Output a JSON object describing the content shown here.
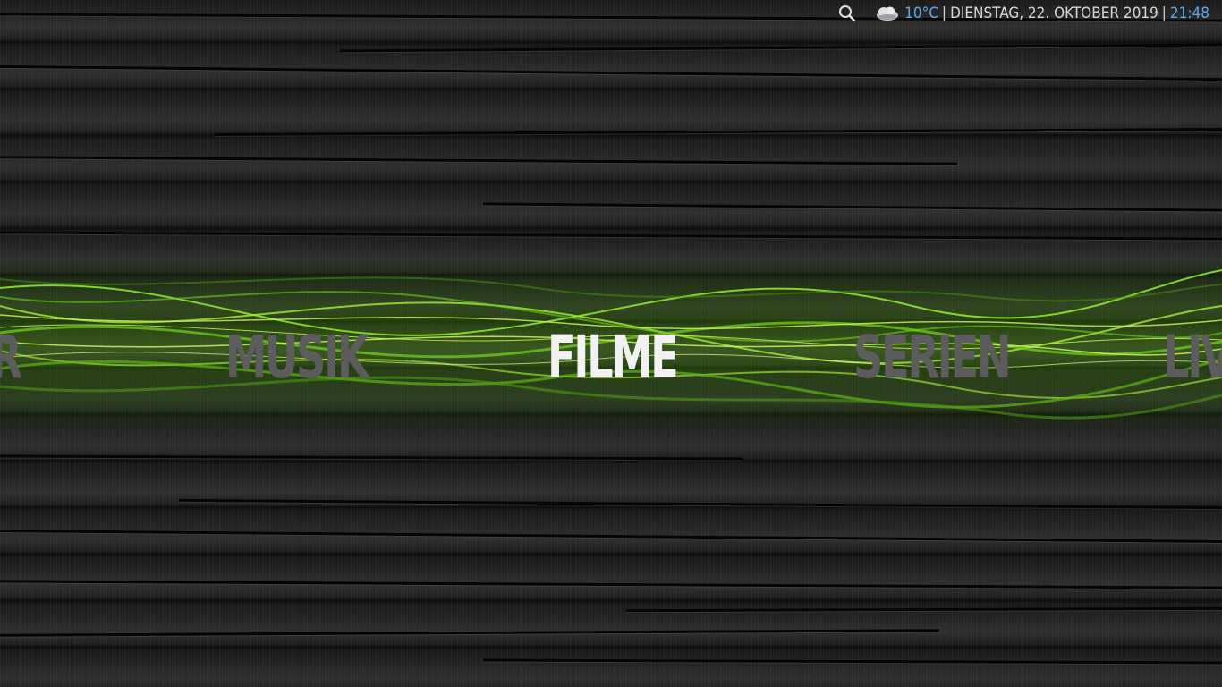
{
  "topbar": {
    "temperature": "10°C",
    "date": "DIENSTAG, 22. OKTOBER 2019",
    "time": "21:48",
    "separator": "|",
    "search_icon": "search-icon",
    "weather_icon": "cloud-icon"
  },
  "menu": {
    "items": [
      {
        "label": "ER"
      },
      {
        "label": "MUSIK"
      },
      {
        "label": "FILME"
      },
      {
        "label": "SERIEN"
      },
      {
        "label": "LIV"
      }
    ],
    "selected": "FILME"
  },
  "colors": {
    "accent": "#5fa8e8",
    "active_item": "#f2f2f2",
    "inactive_item": "#5c5c5c",
    "band_green": "#7ed321"
  }
}
